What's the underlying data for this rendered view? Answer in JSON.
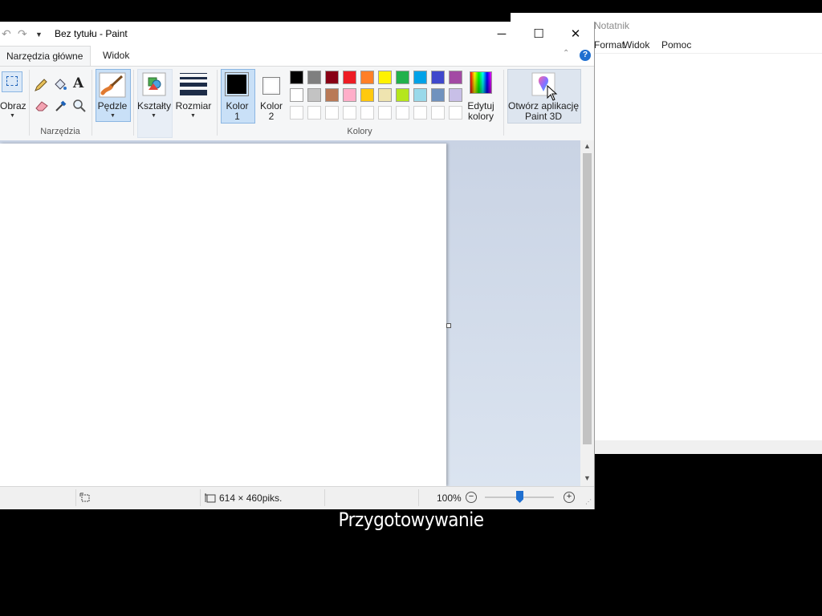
{
  "notepad": {
    "title": "Notatnik",
    "menu": [
      "Format",
      "Widok",
      "Pomoc"
    ]
  },
  "paint": {
    "title": "Bez tytułu - Paint",
    "window_controls": {
      "minimize": "─",
      "maximize": "☐",
      "close": "✕"
    },
    "tabs": [
      "Narzędzia główne",
      "Widok"
    ],
    "ribbon": {
      "image_label": "Obraz",
      "tools_group_label": "Narzędzia",
      "brushes_label": "Pędzle",
      "shapes_label": "Kształty",
      "size_label": "Rozmiar",
      "color1_label": [
        "Kolor",
        "1"
      ],
      "color2_label": [
        "Kolor",
        "2"
      ],
      "colors_group_label": "Kolory",
      "edit_colors_label": [
        "Edytuj",
        "kolory"
      ],
      "paint3d_label": [
        "Otwórz aplikację",
        "Paint 3D"
      ],
      "color1": "#000000",
      "color2": "#ffffff",
      "palette_row1": [
        "#000000",
        "#7f7f7f",
        "#880015",
        "#ed1c24",
        "#ff7f27",
        "#fff200",
        "#22b14c",
        "#00a2e8",
        "#3f48cc",
        "#a349a4"
      ],
      "palette_row2": [
        "#ffffff",
        "#c3c3c3",
        "#b97a57",
        "#ffaec9",
        "#ffc90e",
        "#efe4b0",
        "#b5e61d",
        "#99d9ea",
        "#7092be",
        "#c8bfe7"
      ]
    },
    "status": {
      "dimensions": "614 × 460piks.",
      "zoom": "100%"
    }
  },
  "caption": "Przygotowywanie"
}
